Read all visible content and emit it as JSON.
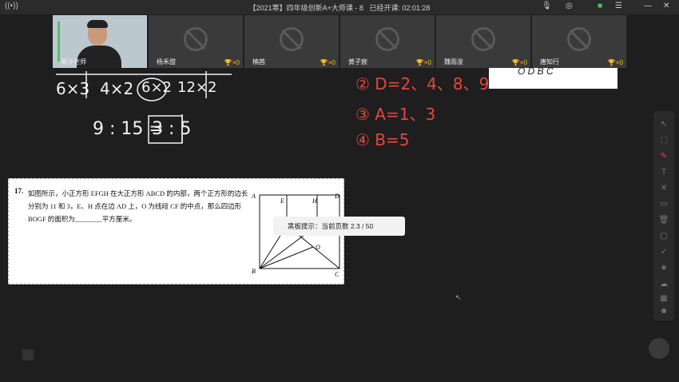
{
  "window": {
    "title": "【2021寒】四年级创新A+大师课 - 8",
    "elapsed_label": "已经开课: 02:01:28",
    "live_icon": "broadcast-icon",
    "controls": [
      "mic-icon",
      "speaker-icon",
      "chat-icon",
      "menu-icon",
      "minimize-icon",
      "close-icon"
    ]
  },
  "participants": [
    {
      "name": "果汁老师",
      "trophy": "",
      "is_teacher": true
    },
    {
      "name": "杨禾甜",
      "trophy": "×0"
    },
    {
      "name": "楠茜",
      "trophy": "×0"
    },
    {
      "name": "黄子宸",
      "trophy": "×0"
    },
    {
      "name": "魏雨浚",
      "trophy": "×0"
    },
    {
      "name": "唐知行",
      "trophy": "×0"
    }
  ],
  "board": {
    "white_row": [
      "6×3",
      "4×2",
      "6×2",
      "12×2"
    ],
    "ratio": "9 : 15 =",
    "ratio_answer": "3 : 5",
    "red_lines": [
      "② D=2、4、8、9",
      "③ A=1、3",
      "④ B=5"
    ],
    "paper_letters": "O  D  B  C"
  },
  "problem": {
    "number": "17.",
    "text": "如图所示，小正方形 EFGH 在大正方形 ABCD 的内部，两个正方形的边长分别为 11 和 3，E、H 点在边 AD 上，O 为线段 CF 的中点，那么四边形 BOGF 的面积为________平方厘米。",
    "labels": {
      "A": "A",
      "B": "B",
      "C": "C",
      "D": "D",
      "E": "E",
      "H": "H",
      "O": "O"
    }
  },
  "tooltip": {
    "text": "黑板提示：当前页数 2.3 / 50"
  },
  "toolbar": [
    "cursor-icon",
    "select-icon",
    "pen-icon",
    "text-icon",
    "eraser-icon",
    "shape-icon",
    "trash-icon",
    "page-icon",
    "check-icon",
    "reward-icon",
    "cloud-icon",
    "grid-icon",
    "group-icon"
  ]
}
